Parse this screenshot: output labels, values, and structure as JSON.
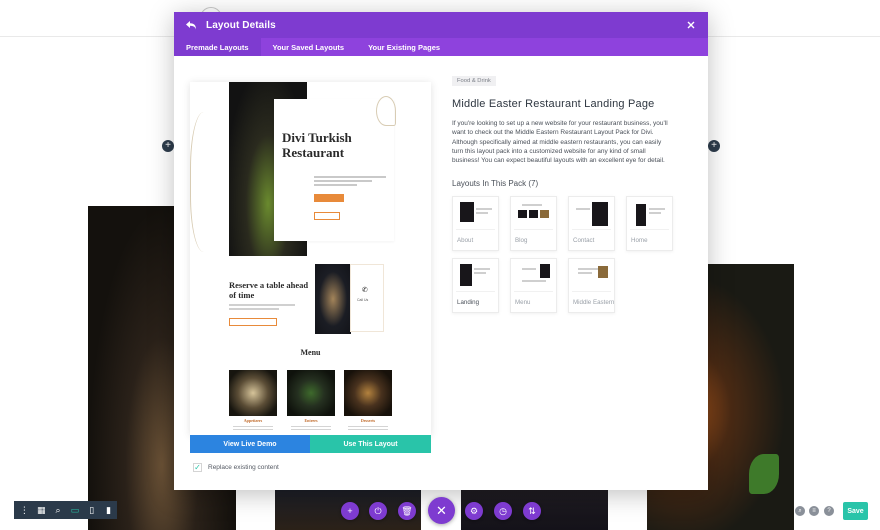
{
  "modal": {
    "title": "Layout Details",
    "back_icon": "back-arrow-icon",
    "close_icon": "close-icon",
    "tabs": [
      {
        "label": "Premade Layouts",
        "active": true
      },
      {
        "label": "Your Saved Layouts",
        "active": false
      },
      {
        "label": "Your Existing Pages",
        "active": false
      }
    ],
    "accent_color": "#7e3bd0"
  },
  "preview": {
    "hero_title": "Divi Turkish Restaurant",
    "reserve_title": "Reserve a table ahead of time",
    "menu_title": "Menu",
    "dishes": [
      "Appetizers",
      "Entrees",
      "Desserts"
    ],
    "call_text": "Call Us"
  },
  "actions": {
    "view_demo": "View Live Demo",
    "use_layout": "Use This Layout",
    "demo_color": "#2c84e0",
    "use_color": "#29c4a9"
  },
  "replace": {
    "label": "Replace existing content",
    "checked": true
  },
  "details": {
    "category": "Food & Drink",
    "title": "Middle Easter Restaurant Landing Page",
    "description": "If you're looking to set up a new website for your restaurant business, you'll want to check out the Middle Eastern Restaurant Layout Pack for Divi. Although specifically aimed at middle eastern restaurants, you can easily turn this layout pack into a customized website for any kind of small business! You can expect beautiful layouts with an excellent eye for detail.",
    "pack_heading": "Layouts In This Pack (7)",
    "layouts": [
      {
        "label": "About",
        "selected": false
      },
      {
        "label": "Blog",
        "selected": false
      },
      {
        "label": "Contact",
        "selected": false
      },
      {
        "label": "Home",
        "selected": false
      },
      {
        "label": "Landing",
        "selected": true
      },
      {
        "label": "Menu",
        "selected": false
      },
      {
        "label": "Middle Eastern Restaurant",
        "selected": false
      }
    ]
  },
  "toolbar": {
    "left_icons": [
      "more-vertical-icon",
      "wireframe-icon",
      "zoom-icon",
      "desktop-icon",
      "tablet-icon",
      "phone-icon"
    ],
    "center_icons": [
      "add-icon",
      "power-icon",
      "trash-icon",
      "close-icon",
      "settings-icon",
      "history-icon",
      "portability-icon"
    ],
    "right_icons": [
      "search-icon",
      "layers-icon",
      "help-icon"
    ],
    "save_label": "Save"
  }
}
